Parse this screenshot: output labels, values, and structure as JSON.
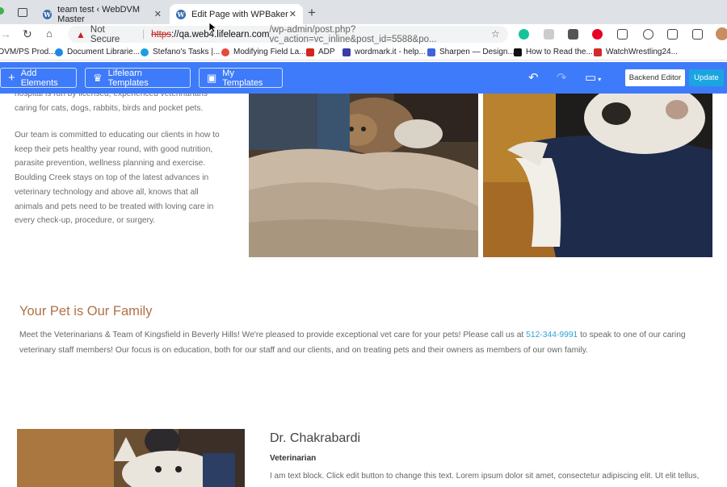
{
  "browser": {
    "tabs": [
      {
        "title": "team test ‹ WebDVM Master"
      },
      {
        "title": "Edit Page with WPBakery Page"
      }
    ],
    "address": {
      "security": "Not Secure",
      "scheme": "https",
      "host": "://qa.web4.lifelearn.com",
      "path": "/wp-admin/post.php?vc_action=vc_inline&post_id=5588&po..."
    },
    "bookmarks": [
      {
        "label": "DVM/PS Prod..."
      },
      {
        "label": "Document Librarie..."
      },
      {
        "label": "Stefano's Tasks |..."
      },
      {
        "label": "Modifying Field La..."
      },
      {
        "label": "ADP"
      },
      {
        "label": "wordmark.it - help..."
      },
      {
        "label": "Sharpen — Design..."
      },
      {
        "label": "How to Read the..."
      },
      {
        "label": "WatchWrestling24..."
      }
    ]
  },
  "toolbar": {
    "add_elements": "Add Elements",
    "lifelearn_templates": "Lifelearn Templates",
    "my_templates": "My Templates",
    "backend_editor": "Backend Editor",
    "update": "Update"
  },
  "intro": {
    "para1": "hospital is run by licensed, experienced veterinarians caring for cats, dogs, rabbits, birds and pocket pets.",
    "para2": "Our team is committed to educating our clients in how to keep their pets healthy year round, with good nutrition, parasite prevention, wellness planning and exercise. Boulding Creek stays on top of the latest advances in veterinary technology and above all, knows that all animals and pets need to be treated with loving care in every check-up, procedure, or surgery."
  },
  "family": {
    "heading": "Your Pet is Our Family",
    "text_before": "Meet the Veterinarians & Team of Kingsfield in Beverly Hills! We're pleased to provide exceptional vet care for your pets! Please call us at ",
    "phone": "512-344-9991",
    "text_after": " to speak to one of our caring veterinary staff members! Our focus is on education, both for our staff and our clients, and on treating pets and their owners as members of our own family."
  },
  "doctor": {
    "name": "Dr. Chakrabardi",
    "role": "Veterinarian",
    "bio": "I am text block. Click edit button to change this text. Lorem ipsum dolor sit amet, consectetur adipiscing elit. Ut elit tellus,"
  }
}
